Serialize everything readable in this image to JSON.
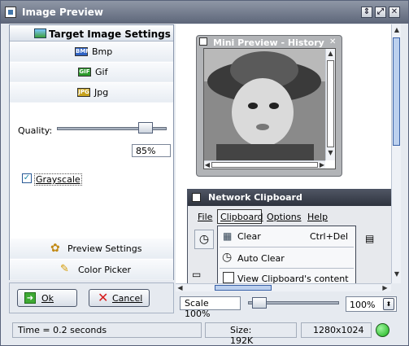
{
  "window": {
    "title": "Image Preview",
    "controls": [
      "⇕",
      "⤢",
      "✕"
    ]
  },
  "target_settings": {
    "header": "Target Image Settings",
    "formats": [
      {
        "icon": "BMP",
        "label": "Bmp"
      },
      {
        "icon": "GIF",
        "label": "Gif"
      },
      {
        "icon": "JPG",
        "label": "Jpg"
      }
    ],
    "quality_label": "Quality:",
    "quality_value": "85%",
    "quality_fraction": 0.85,
    "grayscale_label": "Grayscale",
    "grayscale_checked": true
  },
  "sections": {
    "preview_settings": "Preview Settings",
    "color_picker": "Color Picker"
  },
  "buttons": {
    "ok": "Ok",
    "cancel": "Cancel"
  },
  "mini_preview": {
    "title": "Mini Preview - History",
    "close": "✕"
  },
  "clipboard": {
    "title": "Network Clipboard",
    "menu": [
      "File",
      "Clipboard",
      "Options",
      "Help"
    ],
    "dropdown": [
      {
        "label": "Clear",
        "shortcut": "Ctrl+Del"
      },
      {
        "label": "Auto Clear",
        "shortcut": ""
      },
      {
        "label": "View Clipboard's content",
        "shortcut": ""
      }
    ]
  },
  "zoom": {
    "scale_label": "Scale 100%",
    "value": "100%",
    "slider_fraction": 0.0
  },
  "status": {
    "time": "Time = 0.2 seconds",
    "size": "Size: 192K",
    "dimensions": "1280x1024",
    "indicator_color": "#19b319"
  }
}
